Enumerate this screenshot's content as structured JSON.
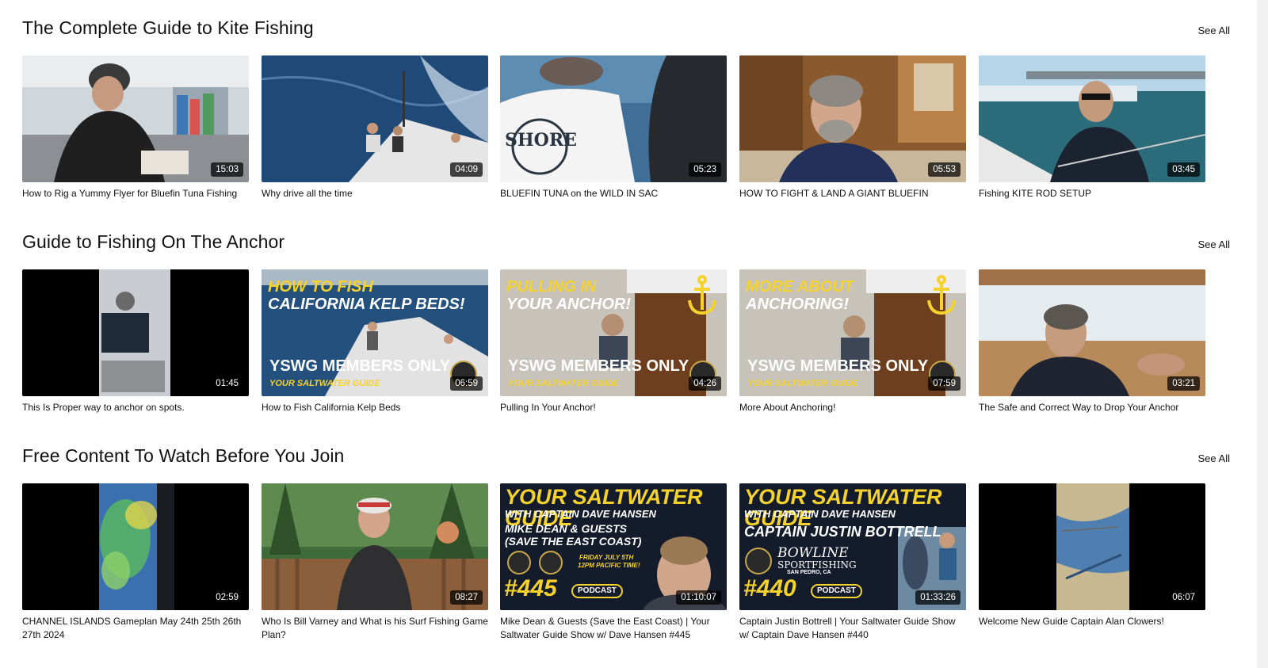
{
  "sections": [
    {
      "title": "The Complete Guide to Kite Fishing",
      "see_all": "See All",
      "videos": [
        {
          "title": "How to Rig a Yummy Flyer for Bluefin Tuna Fishing",
          "duration": "15:03"
        },
        {
          "title": "Why drive all the time",
          "duration": "04:09"
        },
        {
          "title": "BLUEFIN TUNA on the WILD IN SAC",
          "duration": "05:23",
          "shirt_text": "SHORE"
        },
        {
          "title": "HOW TO FIGHT & LAND A GIANT BLUEFIN",
          "duration": "05:53"
        },
        {
          "title": "Fishing KITE ROD SETUP",
          "duration": "03:45"
        }
      ]
    },
    {
      "title": "Guide to Fishing On The Anchor",
      "see_all": "See All",
      "videos": [
        {
          "title": "This Is Proper way to anchor on spots.",
          "duration": "01:45"
        },
        {
          "title": "How to Fish California Kelp Beds",
          "duration": "06:59",
          "overlay_line1": "HOW TO FISH",
          "overlay_line2": "CALIFORNIA KELP BEDS!",
          "members": "YSWG MEMBERS ONLY",
          "brand": "YOUR SALTWATER GUIDE"
        },
        {
          "title": "Pulling In Your Anchor!",
          "duration": "04:26",
          "overlay_line1": "PULLING IN",
          "overlay_line2": "YOUR ANCHOR!",
          "members": "YSWG MEMBERS ONLY",
          "brand": "YOUR SALTWATER GUIDE"
        },
        {
          "title": "More About Anchoring!",
          "duration": "07:59",
          "overlay_line1": "MORE ABOUT",
          "overlay_line2": "ANCHORING!",
          "members": "YSWG MEMBERS ONLY",
          "brand": "YOUR SALTWATER GUIDE"
        },
        {
          "title": "The Safe and Correct Way to Drop Your Anchor",
          "duration": "03:21"
        }
      ]
    },
    {
      "title": "Free Content To Watch Before You Join",
      "see_all": "See All",
      "videos": [
        {
          "title": "CHANNEL ISLANDS Gameplan May 24th 25th 26th 27th 2024",
          "duration": "02:59"
        },
        {
          "title": "Who Is Bill Varney and What is his Surf Fishing Game Plan?",
          "duration": "08:27"
        },
        {
          "title": "Mike Dean & Guests (Save the East Coast) | Your Saltwater Guide Show w/ Dave Hansen #445",
          "duration": "01:10:07",
          "poster_title": "YOUR SALTWATER GUIDE",
          "poster_sub": "WITH CAPTAIN DAVE HANSEN",
          "poster_guest1": "MIKE DEAN & GUESTS",
          "poster_guest2": "(SAVE THE EAST COAST)",
          "poster_date1": "FRIDAY JULY 5TH",
          "poster_date2": "12PM PACIFIC TIME!",
          "poster_num": "#445",
          "poster_badge": "PODCAST"
        },
        {
          "title": "Captain Justin Bottrell | Your Saltwater Guide Show w/ Captain Dave Hansen #440",
          "duration": "01:33:26",
          "poster_title": "YOUR SALTWATER GUIDE",
          "poster_sub": "WITH CAPTAIN DAVE HANSEN",
          "poster_guest1": "CAPTAIN JUSTIN BOTTRELL",
          "poster_sponsor1": "BOWLINE",
          "poster_sponsor2": "SPORTFISHING",
          "poster_sponsor3": "SAN PEDRO, CA",
          "poster_num": "#440",
          "poster_badge": "PODCAST"
        },
        {
          "title": "Welcome New Guide Captain Alan Clowers!",
          "duration": "06:07"
        }
      ]
    }
  ],
  "colors": {
    "poster_yellow": "#f6d22c",
    "poster_bg": "#141c2b",
    "duration_bg": "#000000"
  }
}
